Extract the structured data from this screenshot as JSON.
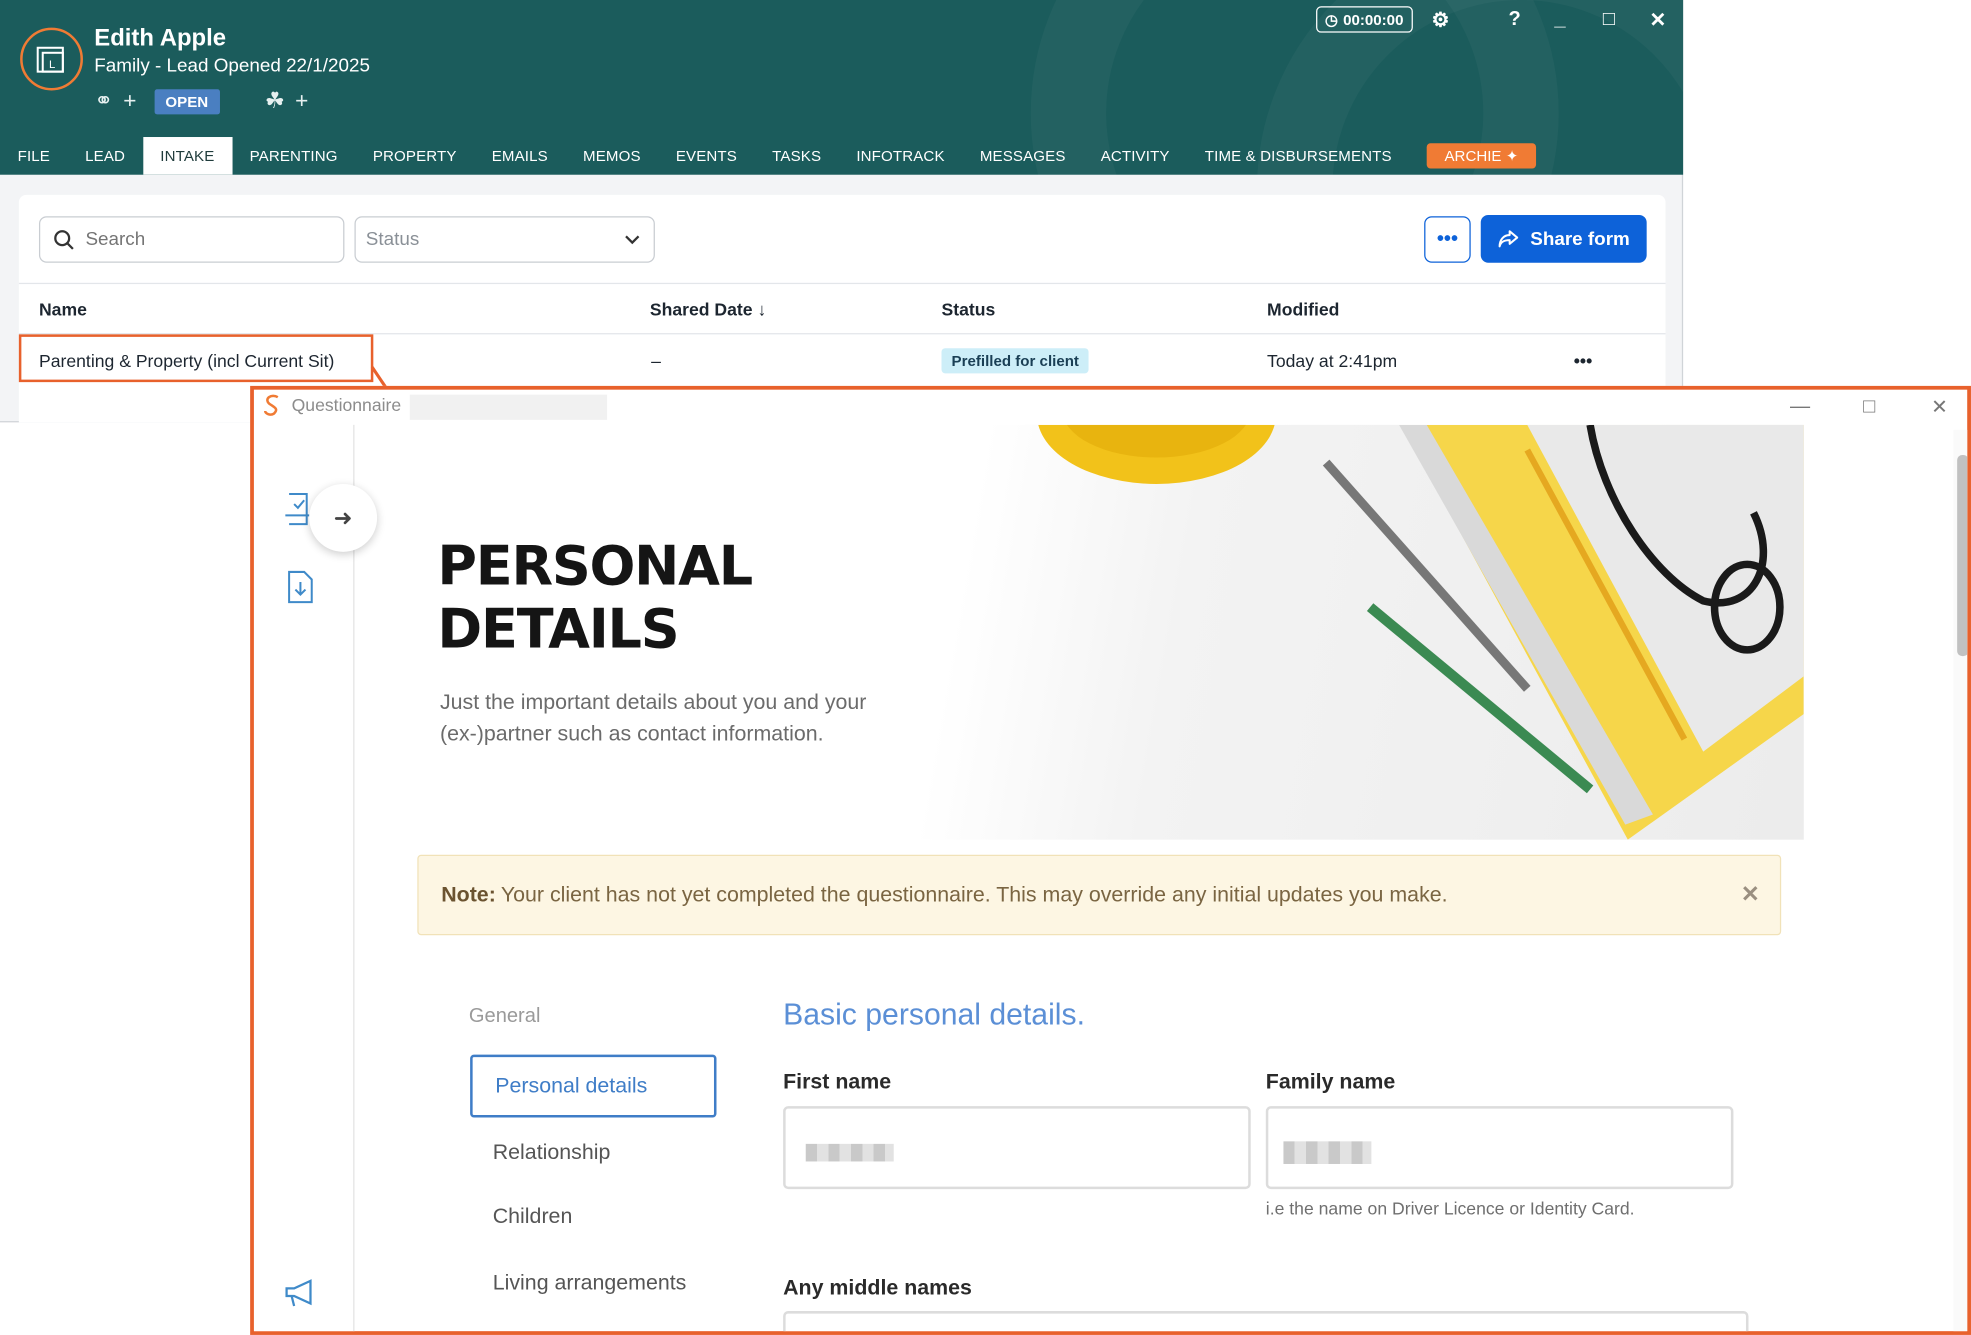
{
  "app": {
    "matter_name": "Edith Apple",
    "matter_subtitle": "Family - Lead Opened 22/1/2025",
    "status_badge": "OPEN",
    "timer": "00:00:00",
    "tabs": [
      {
        "label": "FILE"
      },
      {
        "label": "LEAD"
      },
      {
        "label": "INTAKE",
        "active": true
      },
      {
        "label": "PARENTING"
      },
      {
        "label": "PROPERTY"
      },
      {
        "label": "EMAILS"
      },
      {
        "label": "MEMOS"
      },
      {
        "label": "EVENTS"
      },
      {
        "label": "TASKS"
      },
      {
        "label": "INFOTRACK"
      },
      {
        "label": "MESSAGES"
      },
      {
        "label": "ACTIVITY"
      },
      {
        "label": "TIME & DISBURSEMENTS"
      }
    ],
    "archie_label": "ARCHIE",
    "accent_color": "#f07b34",
    "header_color": "#1b5c5c"
  },
  "toolbar": {
    "search_placeholder": "Search",
    "status_placeholder": "Status",
    "more_label": "•••",
    "share_label": "Share form"
  },
  "table": {
    "columns": [
      "Name",
      "Shared Date",
      "Status",
      "Modified"
    ],
    "rows": [
      {
        "name": "Parenting & Property (incl Current Sit)",
        "shared_date": "–",
        "status": "Prefilled for client",
        "modified": "Today at 2:41pm",
        "more": "•••"
      }
    ]
  },
  "questionnaire": {
    "window_title": "Questionnaire",
    "hero_title_line1": "PERSONAL",
    "hero_title_line2": "DETAILS",
    "hero_subtitle": "Just the important details about you and your (ex-)partner such as contact information.",
    "note_label": "Note:",
    "note_text": "Your client has not yet completed the questionnaire. This may override any initial updates you make.",
    "section_group": "General",
    "nav": [
      {
        "label": "Personal details",
        "active": true
      },
      {
        "label": "Relationship"
      },
      {
        "label": "Children"
      },
      {
        "label": "Living arrangements"
      }
    ],
    "section_title": "Basic personal details.",
    "fields": {
      "first_name_label": "First name",
      "family_name_label": "Family name",
      "family_name_hint": "i.e the name on Driver Licence or Identity Card.",
      "middle_names_label": "Any middle names"
    }
  }
}
